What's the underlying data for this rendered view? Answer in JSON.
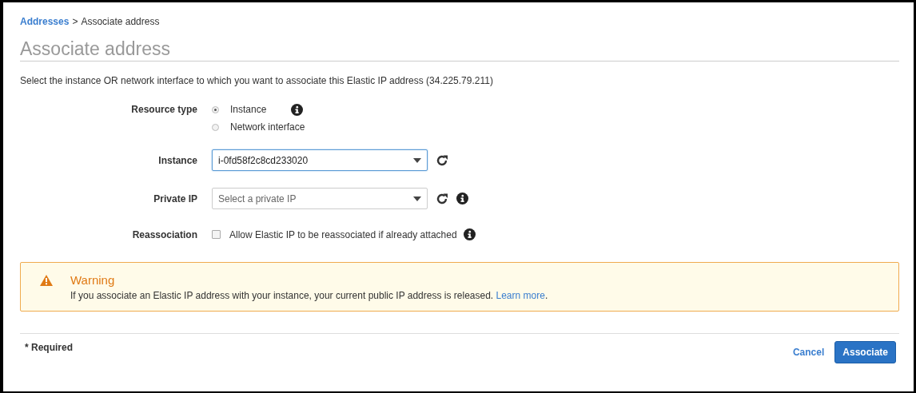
{
  "breadcrumb": {
    "link": "Addresses",
    "separator": ">",
    "current": "Associate address"
  },
  "title": "Associate address",
  "description": "Select the instance OR network interface to which you want to associate this Elastic IP address (34.225.79.211)",
  "form": {
    "resource_type": {
      "label": "Resource type",
      "options": [
        {
          "label": "Instance",
          "selected": true
        },
        {
          "label": "Network interface",
          "selected": false
        }
      ]
    },
    "instance": {
      "label": "Instance",
      "value": "i-0fd58f2c8cd233020"
    },
    "private_ip": {
      "label": "Private IP",
      "placeholder": "Select a private IP"
    },
    "reassociation": {
      "label": "Reassociation",
      "option": "Allow Elastic IP to be reassociated if already attached",
      "checked": false
    }
  },
  "warning": {
    "title": "Warning",
    "message": "If you associate an Elastic IP address with your instance, your current public IP address is released.",
    "link": "Learn more",
    "suffix": "."
  },
  "footer": {
    "required": "* Required",
    "buttons": [
      {
        "label": "Cancel",
        "kind": "link"
      },
      {
        "label": "Associate",
        "kind": "primary"
      }
    ]
  }
}
